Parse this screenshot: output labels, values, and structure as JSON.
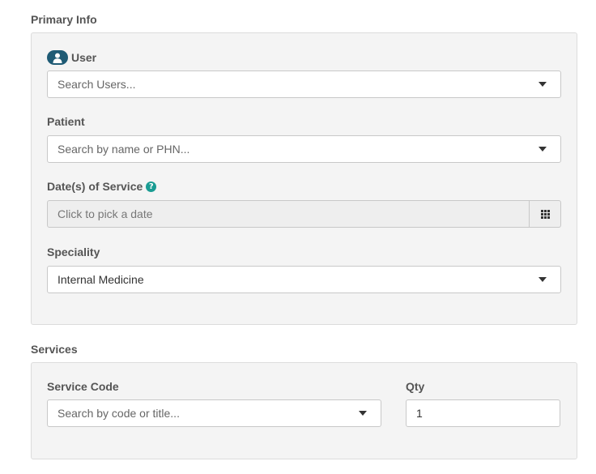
{
  "primary_info": {
    "title": "Primary Info",
    "user": {
      "label": "User",
      "placeholder": "Search Users..."
    },
    "patient": {
      "label": "Patient",
      "placeholder": "Search by name or PHN..."
    },
    "date_of_service": {
      "label": "Date(s) of Service",
      "help_glyph": "?",
      "placeholder": "Click to pick a date"
    },
    "speciality": {
      "label": "Speciality",
      "value": "Internal Medicine"
    }
  },
  "services": {
    "title": "Services",
    "service_code": {
      "label": "Service Code",
      "placeholder": "Search by code or title..."
    },
    "qty": {
      "label": "Qty",
      "value": "1"
    }
  },
  "colors": {
    "user_badge": "#1f5b75",
    "help_icon": "#1a9c93",
    "panel_bg": "#f4f4f4"
  },
  "icons": [
    "user-icon",
    "caret-down-icon",
    "help-icon",
    "calendar-grid-icon"
  ]
}
